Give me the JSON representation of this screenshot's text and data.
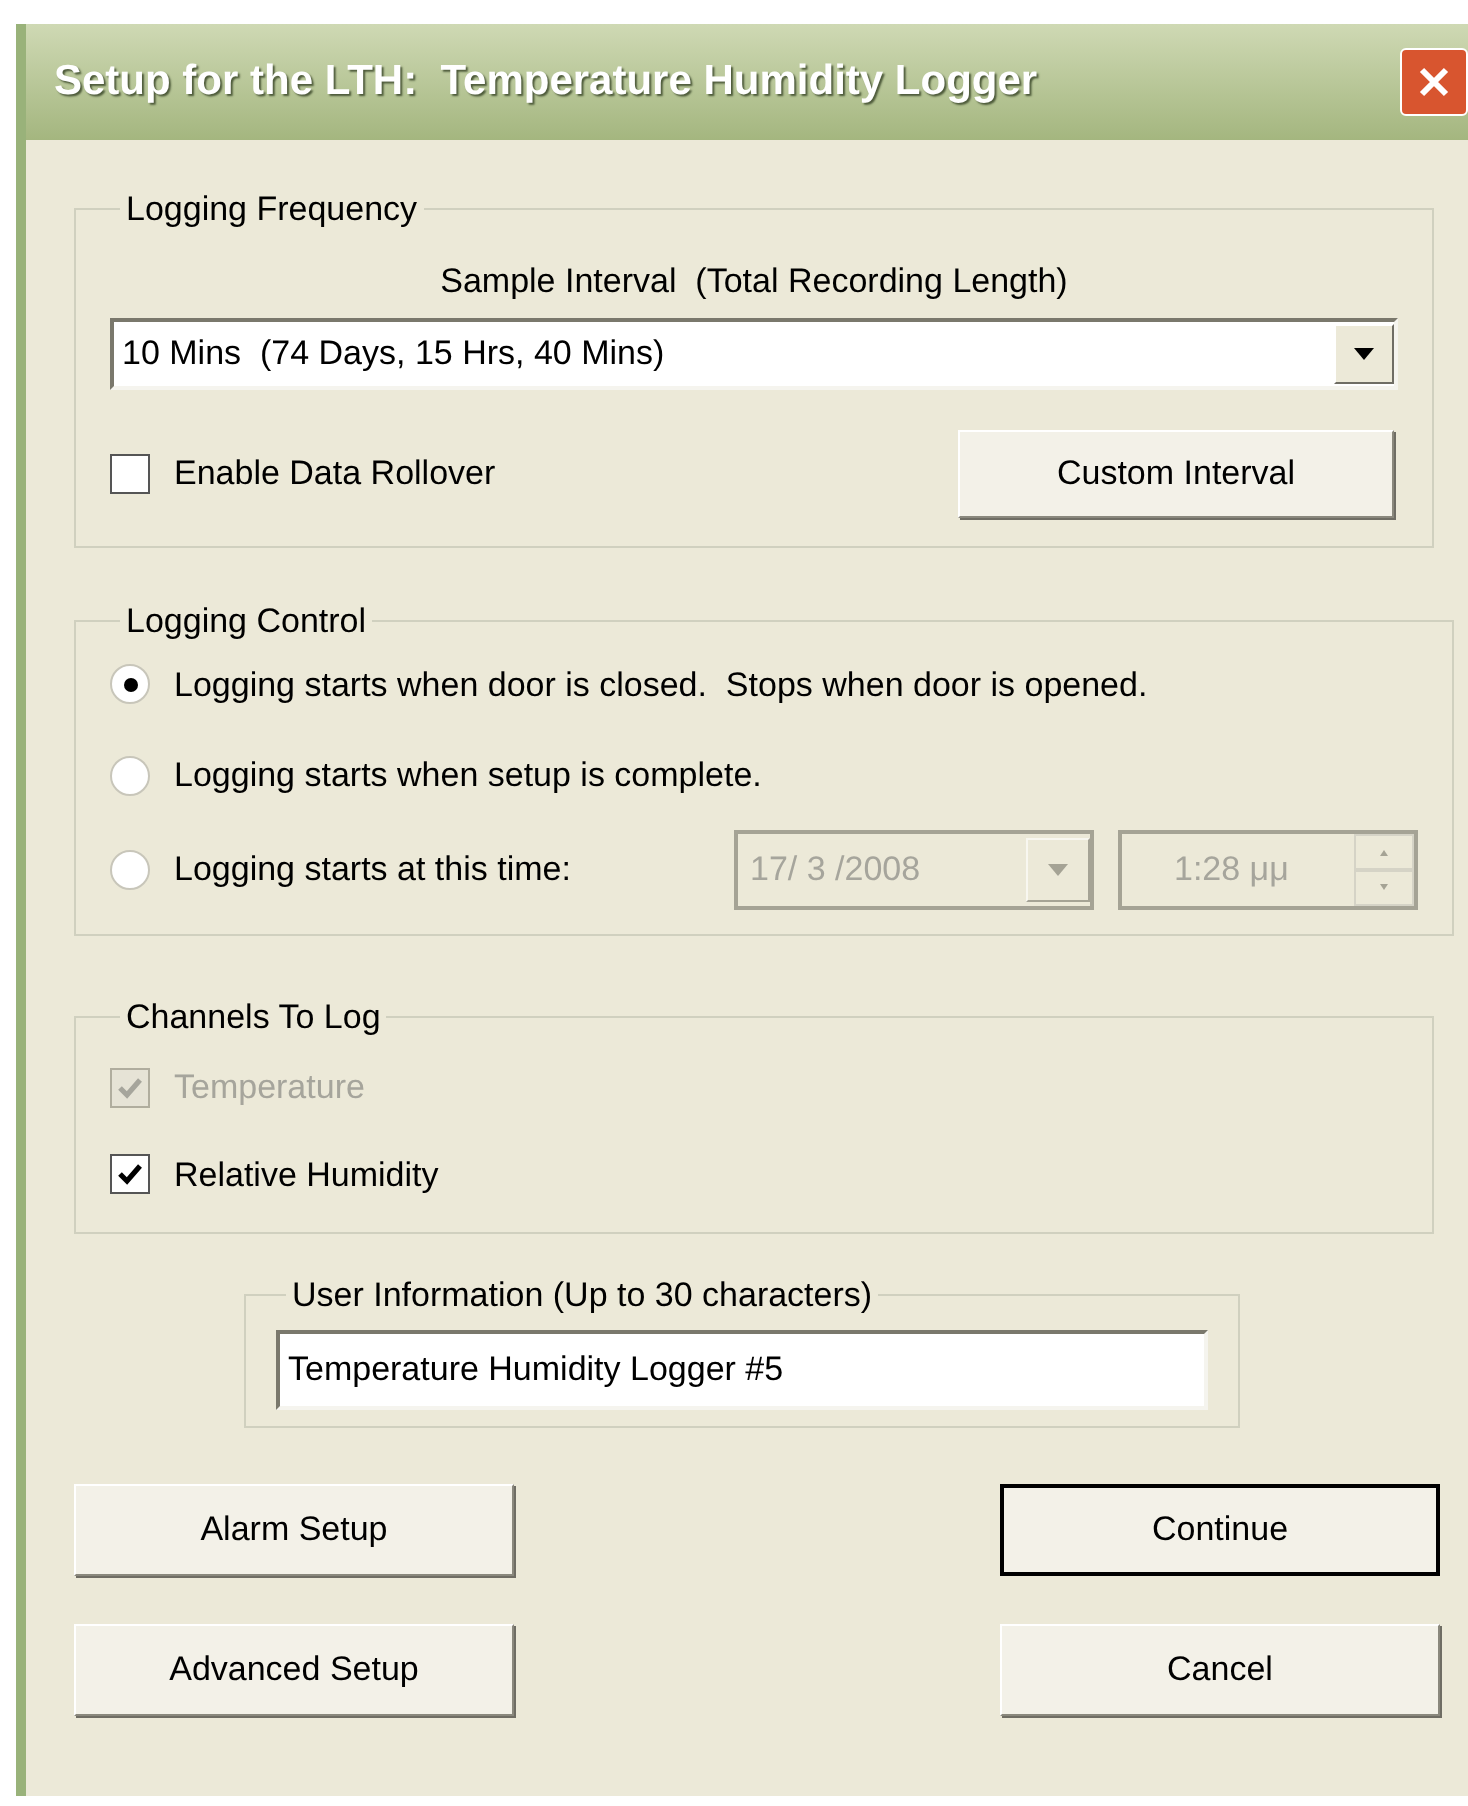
{
  "window": {
    "title": "Setup for the LTH:  Temperature Humidity Logger"
  },
  "logging_frequency": {
    "label": "Logging Frequency",
    "sample_interval_label": "Sample Interval  (Total Recording Length)",
    "interval": "10 Mins  (74 Days, 15 Hrs, 40 Mins)",
    "rollover": {
      "label": "Enable Data Rollover",
      "checked": false
    },
    "custom_button": "Custom Interval"
  },
  "logging_control": {
    "label": "Logging Control",
    "options": [
      {
        "label": "Logging starts when door is closed.  Stops when door is opened.",
        "selected": true
      },
      {
        "label": "Logging starts when setup is complete.",
        "selected": false
      },
      {
        "label": "Logging starts at this time:",
        "selected": false
      }
    ],
    "start_date": {
      "value": "17/ 3 /2008",
      "disabled": true
    },
    "start_time": {
      "value": "1:28 μμ",
      "disabled": true
    }
  },
  "channels": {
    "label": "Channels To Log",
    "items": [
      {
        "label": "Temperature",
        "checked": true,
        "disabled": true
      },
      {
        "label": "Relative Humidity",
        "checked": true,
        "disabled": false
      }
    ]
  },
  "user_information": {
    "label": "User Information (Up to 30 characters)",
    "value": "Temperature Humidity Logger #5"
  },
  "buttons": [
    {
      "label": "Alarm Setup",
      "default": false
    },
    {
      "label": "Continue",
      "default": true
    },
    {
      "label": "Advanced Setup",
      "default": false
    },
    {
      "label": "Cancel",
      "default": false
    }
  ]
}
